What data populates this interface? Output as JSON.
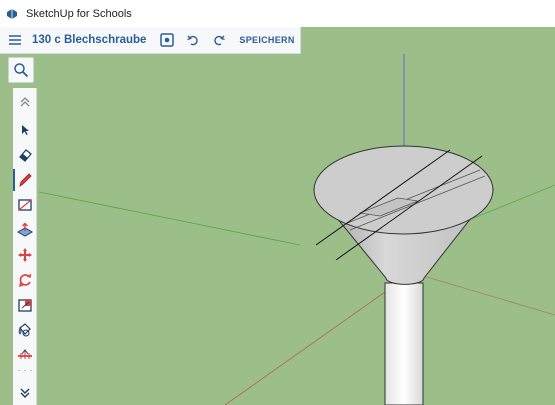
{
  "window": {
    "title": "SketchUp for Schools"
  },
  "toolbar": {
    "model_name": "130 c Blechschraube",
    "save_label": "SPEICHERN"
  },
  "icons": {
    "app": "sketchup-logo-icon",
    "menu": "hamburger-menu-icon",
    "scenes": "camera-scenes-icon",
    "undo": "undo-icon",
    "redo": "redo-icon",
    "search": "search-icon",
    "collapse": "chevron-up-double-icon",
    "expand": "chevron-down-double-icon"
  },
  "tools": [
    "select-arrow-icon",
    "eraser-icon",
    "pencil-line-icon",
    "rectangle-icon",
    "push-pull-icon",
    "move-icon",
    "rotate-icon",
    "scale-icon",
    "paint-bucket-icon",
    "tape-measure-icon"
  ],
  "colors": {
    "accent": "#2a5d9a",
    "background": "#9cbe88"
  }
}
